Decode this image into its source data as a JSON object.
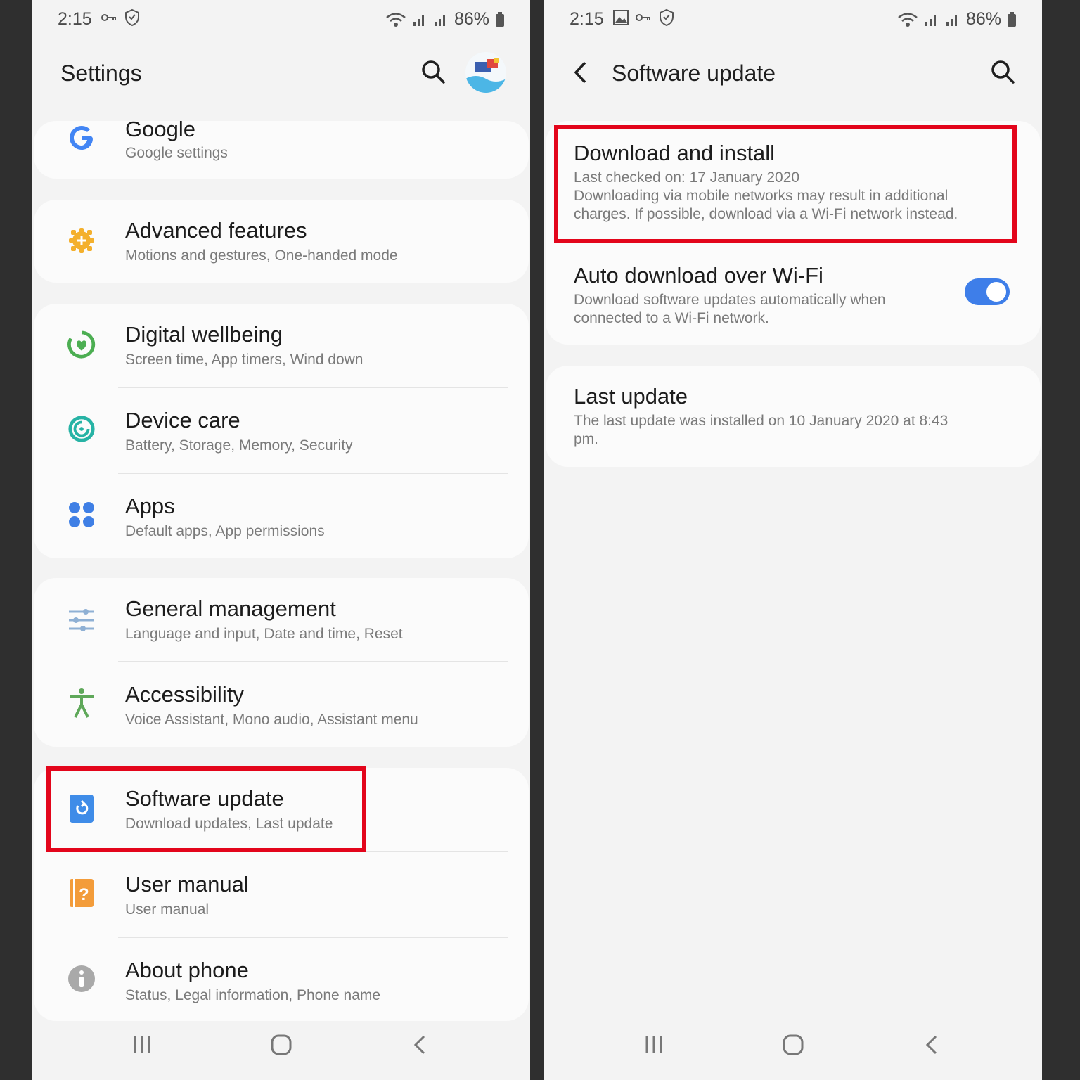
{
  "left": {
    "status": {
      "time": "2:15",
      "battery": "86%"
    },
    "header": {
      "title": "Settings"
    },
    "items": [
      {
        "title": "Google",
        "subtitle": "Google settings"
      },
      {
        "title": "Advanced features",
        "subtitle": "Motions and gestures, One-handed mode"
      },
      {
        "title": "Digital wellbeing",
        "subtitle": "Screen time, App timers, Wind down"
      },
      {
        "title": "Device care",
        "subtitle": "Battery, Storage, Memory, Security"
      },
      {
        "title": "Apps",
        "subtitle": "Default apps, App permissions"
      },
      {
        "title": "General management",
        "subtitle": "Language and input, Date and time, Reset"
      },
      {
        "title": "Accessibility",
        "subtitle": "Voice Assistant, Mono audio, Assistant menu"
      },
      {
        "title": "Software update",
        "subtitle": "Download updates, Last update"
      },
      {
        "title": "User manual",
        "subtitle": "User manual"
      },
      {
        "title": "About phone",
        "subtitle": "Status, Legal information, Phone name"
      }
    ]
  },
  "right": {
    "status": {
      "time": "2:15",
      "battery": "86%"
    },
    "header": {
      "title": "Software update"
    },
    "download": {
      "title": "Download and install",
      "line1": "Last checked on: 17 January 2020",
      "line2": "Downloading via mobile networks may result in additional",
      "line3": "charges. If possible, download via a Wi-Fi network instead."
    },
    "auto": {
      "title": "Auto download over Wi-Fi",
      "line1": "Download software updates automatically when",
      "line2": "connected to a Wi-Fi network.",
      "enabled": true
    },
    "last": {
      "title": "Last update",
      "line1": "The last update was installed on 10 January 2020 at 8:43",
      "line2": "pm."
    }
  },
  "colors": {
    "accent": "#3e7ee9",
    "highlight": "#e3051b"
  }
}
